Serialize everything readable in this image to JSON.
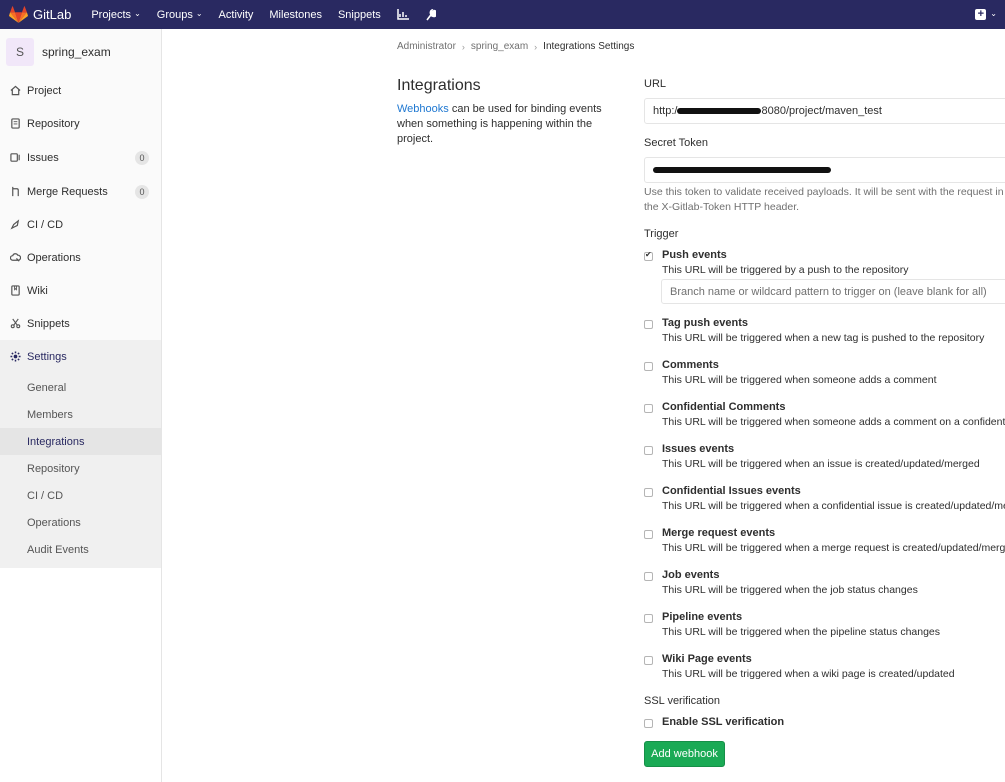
{
  "topnav": {
    "brand": "GitLab",
    "projects": "Projects",
    "groups": "Groups",
    "activity": "Activity",
    "milestones": "Milestones",
    "snippets": "Snippets"
  },
  "sidebar": {
    "avatar_letter": "S",
    "project_name": "spring_exam",
    "items": [
      {
        "label": "Project",
        "icon": "home-icon"
      },
      {
        "label": "Repository",
        "icon": "doc-icon"
      },
      {
        "label": "Issues",
        "icon": "issues-icon",
        "count": "0"
      },
      {
        "label": "Merge Requests",
        "icon": "merge-icon",
        "count": "0"
      },
      {
        "label": "CI / CD",
        "icon": "rocket-icon"
      },
      {
        "label": "Operations",
        "icon": "cloud-icon"
      },
      {
        "label": "Wiki",
        "icon": "book-icon"
      },
      {
        "label": "Snippets",
        "icon": "scissors-icon"
      },
      {
        "label": "Settings",
        "icon": "gear-icon"
      }
    ],
    "settings_sub": [
      "General",
      "Members",
      "Integrations",
      "Repository",
      "CI / CD",
      "Operations",
      "Audit Events"
    ]
  },
  "breadcrumb": [
    "Administrator",
    "spring_exam",
    "Integrations Settings"
  ],
  "intro": {
    "title": "Integrations",
    "link": "Webhooks",
    "text": " can be used for binding events when something is happening within the project."
  },
  "form": {
    "url_label": "URL",
    "url_prefix": "http:/",
    "url_suffix": "8080/project/maven_test",
    "token_label": "Secret Token",
    "token_help": "Use this token to validate received payloads. It will be sent with the request in the X-Gitlab-Token HTTP header.",
    "trigger_label": "Trigger",
    "branch_placeholder": "Branch name or wildcard pattern to trigger on (leave blank for all)",
    "ssl_label": "SSL verification",
    "ssl_option": "Enable SSL verification",
    "submit": "Add webhook"
  },
  "events": [
    {
      "title": "Push events",
      "desc": "This URL will be triggered by a push to the repository",
      "checked": true
    },
    {
      "title": "Tag push events",
      "desc": "This URL will be triggered when a new tag is pushed to the repository",
      "checked": false
    },
    {
      "title": "Comments",
      "desc": "This URL will be triggered when someone adds a comment",
      "checked": false
    },
    {
      "title": "Confidential Comments",
      "desc": "This URL will be triggered when someone adds a comment on a confidential issue",
      "checked": false
    },
    {
      "title": "Issues events",
      "desc": "This URL will be triggered when an issue is created/updated/merged",
      "checked": false
    },
    {
      "title": "Confidential Issues events",
      "desc": "This URL will be triggered when a confidential issue is created/updated/merged",
      "checked": false
    },
    {
      "title": "Merge request events",
      "desc": "This URL will be triggered when a merge request is created/updated/merged",
      "checked": false
    },
    {
      "title": "Job events",
      "desc": "This URL will be triggered when the job status changes",
      "checked": false
    },
    {
      "title": "Pipeline events",
      "desc": "This URL will be triggered when the pipeline status changes",
      "checked": false
    },
    {
      "title": "Wiki Page events",
      "desc": "This URL will be triggered when a wiki page is created/updated",
      "checked": false
    }
  ],
  "colors": {
    "nav": "#292961",
    "primary_button": "#1aaa55",
    "link": "#1f78d1"
  }
}
